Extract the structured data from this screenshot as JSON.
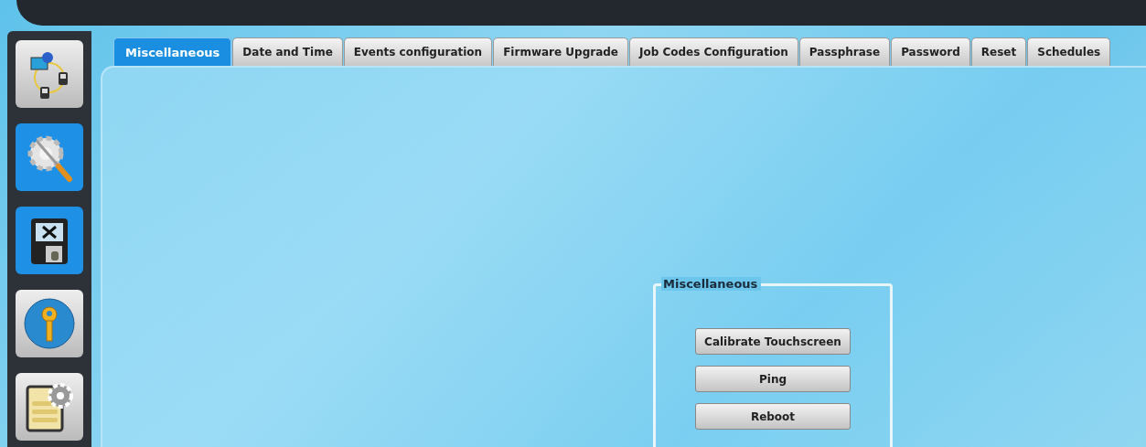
{
  "sidebar": {
    "items": [
      {
        "kind": "network",
        "selected": false
      },
      {
        "kind": "tools",
        "selected": true
      },
      {
        "kind": "terminal",
        "selected": true
      },
      {
        "kind": "key",
        "selected": false
      },
      {
        "kind": "settings",
        "selected": false
      }
    ]
  },
  "tabs": [
    {
      "label": "Miscellaneous",
      "selected": true
    },
    {
      "label": "Date and Time",
      "selected": false
    },
    {
      "label": "Events configuration",
      "selected": false
    },
    {
      "label": "Firmware Upgrade",
      "selected": false
    },
    {
      "label": "Job Codes Configuration",
      "selected": false
    },
    {
      "label": "Passphrase",
      "selected": false
    },
    {
      "label": "Password",
      "selected": false
    },
    {
      "label": "Reset",
      "selected": false
    },
    {
      "label": "Schedules",
      "selected": false
    }
  ],
  "group": {
    "title": "Miscellaneous",
    "buttons": [
      "Calibrate Touchscreen",
      "Ping",
      "Reboot"
    ]
  }
}
